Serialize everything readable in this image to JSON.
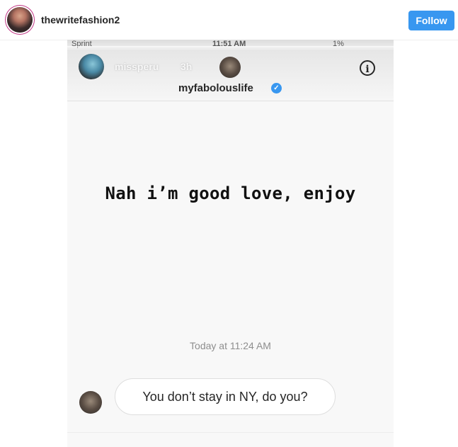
{
  "header": {
    "username": "thewritefashion2",
    "follow_label": "Follow"
  },
  "story": {
    "status_bar": {
      "carrier": "Sprint",
      "time": "11:51 AM",
      "battery": "1%"
    },
    "story_user": "missperu",
    "story_age": "3h",
    "conversation_name": "myfabolouslife",
    "info_label": "i",
    "overlay_text": "Nah i’m good love, enjoy",
    "timestamp": "Today at 11:24 AM",
    "message": "You don’t stay in NY, do you?"
  },
  "colors": {
    "accent": "#3897f0",
    "text": "#262626",
    "muted": "#8e8e8e"
  }
}
